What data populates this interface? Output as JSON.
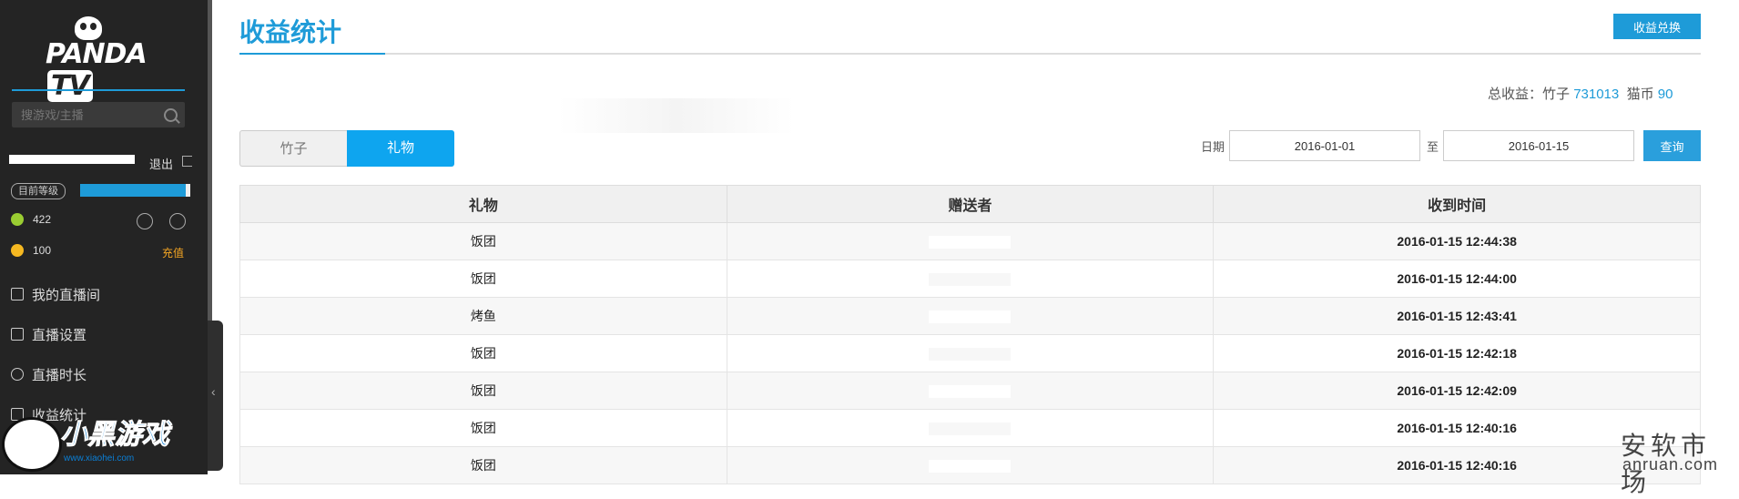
{
  "sidebar": {
    "logo": "PANDA TV",
    "search_placeholder": "搜游戏/主播",
    "logout": "退出",
    "level_badge": "目前等级",
    "bamboo_count": "422",
    "cat_coin_count": "100",
    "recharge": "充值",
    "nav": [
      {
        "label": "我的直播间",
        "icon": "video-icon"
      },
      {
        "label": "直播设置",
        "icon": "sliders-icon"
      },
      {
        "label": "直播时长",
        "icon": "clock-icon"
      },
      {
        "label": "收益统计",
        "icon": "stats-icon"
      }
    ]
  },
  "header": {
    "title": "收益统计",
    "redeem_button": "收益兑换"
  },
  "summary": {
    "label": "总收益：竹子",
    "bamboo_value": "731013",
    "cat_label": "猫币",
    "cat_value": "90"
  },
  "tabs": [
    {
      "label": "竹子",
      "active": false
    },
    {
      "label": "礼物",
      "active": true
    }
  ],
  "filter": {
    "date_label": "日期",
    "start_date": "2016-01-01",
    "to_label": "至",
    "end_date": "2016-01-15",
    "query_button": "查询"
  },
  "table": {
    "columns": [
      "礼物",
      "赠送者",
      "收到时间"
    ],
    "rows": [
      {
        "gift": "饭团",
        "time": "2016-01-15 12:44:38"
      },
      {
        "gift": "饭团",
        "time": "2016-01-15 12:44:00"
      },
      {
        "gift": "烤鱼",
        "time": "2016-01-15 12:43:41"
      },
      {
        "gift": "饭团",
        "time": "2016-01-15 12:42:18"
      },
      {
        "gift": "饭团",
        "time": "2016-01-15 12:42:09"
      },
      {
        "gift": "饭团",
        "time": "2016-01-15 12:40:16"
      },
      {
        "gift": "饭团",
        "time": "2016-01-15 12:40:16"
      }
    ]
  },
  "watermarks": {
    "bottom_left": "小黑游戏",
    "bottom_left_url": "www.xiaohei.com",
    "bottom_right": "安软市场",
    "bottom_right_url": "anruan.com"
  },
  "colors": {
    "accent": "#1e9bd8",
    "sidebar_bg": "#242424",
    "tab_active": "#0ea5ef",
    "recharge": "#f5a623"
  }
}
